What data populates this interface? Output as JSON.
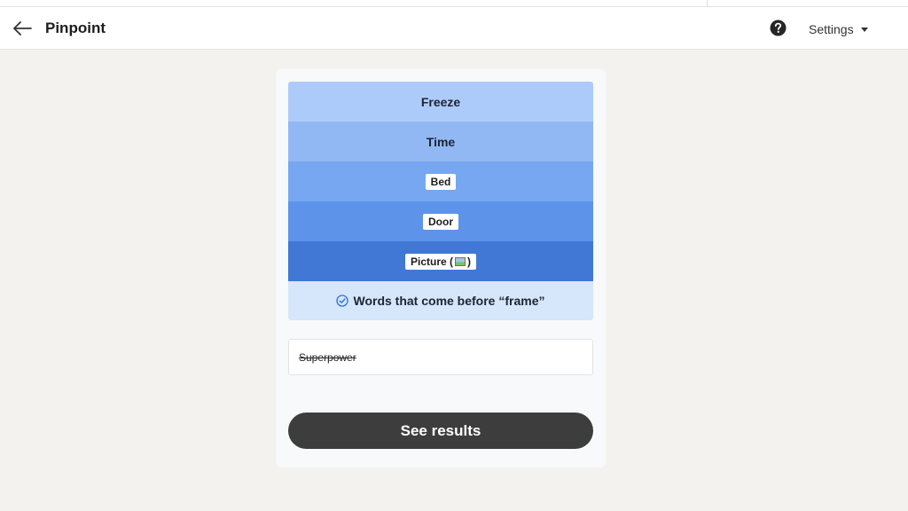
{
  "app": {
    "title": "Pinpoint"
  },
  "header": {
    "back_icon": "arrow-left-icon",
    "help_icon": "question-circle-icon",
    "settings_label": "Settings",
    "settings_icon": "caret-down-icon"
  },
  "puzzle": {
    "clues": [
      {
        "text": "Freeze",
        "color": "#adcbfa",
        "style": "plain"
      },
      {
        "text": "Time",
        "color": "#91b8f3",
        "style": "plain"
      },
      {
        "text": "Bed",
        "color": "#78a7f1",
        "style": "chip"
      },
      {
        "text": "Door",
        "color": "#5d94ea",
        "style": "chip"
      },
      {
        "text": "Picture (",
        "suffix": ")",
        "emoji": "framed-picture-icon",
        "color": "#4178d6",
        "style": "chip"
      }
    ],
    "answer": {
      "text": "Words that come before “frame”",
      "icon": "check-circle-icon",
      "color": "#d6e6fb"
    },
    "guesses": [
      "Superpower"
    ],
    "results_label": "See results"
  },
  "colors": {
    "page_bg": "#f3f2ef",
    "card_bg": "#f8f9fa",
    "button_bg": "#3c3d3c",
    "check_color": "#2f6fd8"
  }
}
